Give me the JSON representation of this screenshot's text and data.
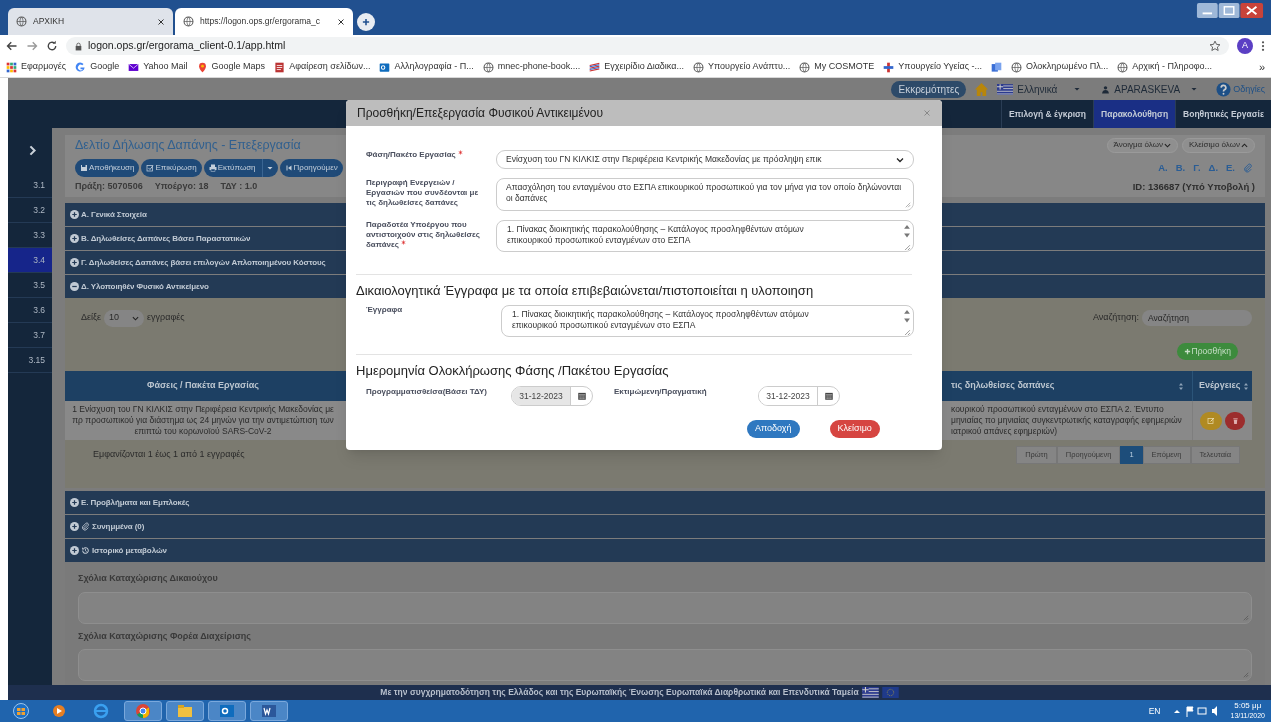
{
  "browser": {
    "tabs": [
      {
        "title": "ΑΡΧΙΚΗ",
        "selected": false
      },
      {
        "title": "https://logon.ops.gr/ergorama_c",
        "selected": true
      }
    ],
    "address": "logon.ops.gr/ergorama_client-0.1/app.html",
    "profile": "A",
    "bookmarks": [
      {
        "label": "Εφαρμογές",
        "kind": "apps"
      },
      {
        "label": "Google",
        "kind": "google"
      },
      {
        "label": "Yahoo Mail",
        "kind": "mail"
      },
      {
        "label": "Google Maps",
        "kind": "pin"
      },
      {
        "label": "Αφαίρεση σελίδων...",
        "kind": "pdf"
      },
      {
        "label": "Αλληλογραφία - Π...",
        "kind": "outlook"
      },
      {
        "label": "mnec-phone-book....",
        "kind": "globe"
      },
      {
        "label": "Εγχειρίδιο Διαδικα...",
        "kind": "stripes"
      },
      {
        "label": "Υπουργείο Ανάπτυ...",
        "kind": "globe"
      },
      {
        "label": "My COSMOTE",
        "kind": "globe"
      },
      {
        "label": "Υπουργείο Υγείας -...",
        "kind": "cross"
      },
      {
        "kind": "docs"
      },
      {
        "label": "Ολοκληρωμένο Πλ...",
        "kind": "globe"
      },
      {
        "label": "Αρχική - Πληροφο...",
        "kind": "globe"
      }
    ],
    "bookmarks_more": "»"
  },
  "header": {
    "pending": "Εκκρεμότητες",
    "language": "Ελληνικά",
    "user": "APARASKEVA",
    "help": "Οδηγίες"
  },
  "nav": [
    {
      "label": "Επιλογή & έγκριση",
      "selected": false
    },
    {
      "label": "Παρακολούθηση",
      "selected": true
    },
    {
      "label": "Βοηθητικές Εργασίε",
      "selected": false
    }
  ],
  "sidebar": [
    {
      "label": "3.1",
      "selected": false
    },
    {
      "label": "3.2",
      "selected": false
    },
    {
      "label": "3.3",
      "selected": false
    },
    {
      "label": "3.4",
      "selected": true
    },
    {
      "label": "3.5",
      "selected": false
    },
    {
      "label": "3.6",
      "selected": false
    },
    {
      "label": "3.7",
      "selected": false
    },
    {
      "label": "3.15",
      "selected": false
    }
  ],
  "form": {
    "title": "Δελτίο Δήλωσης Δαπάνης - Επεξεργασία",
    "toolbar": [
      {
        "label": "Αποθήκευση",
        "kind": "save"
      },
      {
        "label": "Επικύρωση",
        "kind": "check"
      },
      {
        "label": "Εκτύπωση",
        "kind": "print"
      },
      {
        "label": "Προηγούμεν",
        "kind": "previous"
      }
    ],
    "info": [
      "Πράξη: 5070506",
      "Υποέργο: 18",
      "ΤΔΥ : 1.0"
    ],
    "expand_all": "Άνοιγμα όλων",
    "collapse_all": "Κλείσιμο όλων",
    "section_links": [
      "Α.",
      "Β.",
      "Γ.",
      "Δ.",
      "Ε."
    ],
    "record_id": "ID: 136687 (Υπό Υποβολή )"
  },
  "sections_top": [
    {
      "label": "Α. Γενικά Στοιχεία",
      "expanded": false
    },
    {
      "label": "Β. Δηλωθείσες Δαπάνες Βάσει Παραστατικών",
      "expanded": false
    },
    {
      "label": "Γ. Δηλωθείσες Δαπάνες βάσει επιλογών Απλοποιημένου Κόστους",
      "expanded": false
    },
    {
      "label": "Δ. Υλοποιηθέν Φυσικό Αντικείμενο",
      "expanded": true
    }
  ],
  "objects": {
    "show_prefix": "Δείξε",
    "page_size": "10",
    "show_suffix": "εγγραφές",
    "search_label": "Αναζήτηση:",
    "search_placeholder": "Αναζήτηση",
    "add": "Προσθήκη",
    "columns": [
      "Φάσεις / Πακέτα Εργασίας",
      "τις δηλωθείσες δαπάνες",
      "Ενέργειες"
    ],
    "rows": [
      {
        "phase": "1 Ενίσχυση του ΓΝ ΚΙΛΚΙΣ στην Περιφέρεια Κεντρικής Μακεδονίας με πρ προσωπικού για διάστημα ως 24 μηνών για την αντιμετώπιση των επιπτώ του κορωνοϊού SARS-CoV-2",
        "deliverables": "κουρικού προσωπικού ενταγμένων στο ΕΣΠΑ 2. Έντυπο μηνιαίας πο μηνιαίας συγκεντρωτικής καταγραφής εφημεριών ιατρικού απάνες εφημεριών)"
      }
    ],
    "summary": "Εμφανίζονται 1 έως 1 από 1 εγγραφές",
    "pagination": [
      {
        "label": "Πρώτη",
        "selected": false
      },
      {
        "label": "Προηγούμενη",
        "selected": false
      },
      {
        "label": "1",
        "selected": true
      },
      {
        "label": "Επόμενη",
        "selected": false
      },
      {
        "label": "Τελευταία",
        "selected": false
      }
    ]
  },
  "sections_bottom": [
    {
      "label": "Ε. Προβλήματα και Εμπλοκές",
      "kind": "plain",
      "expanded": false
    },
    {
      "label": "Συνημμένα (0)",
      "kind": "attachments",
      "expanded": false
    },
    {
      "label": "Ιστορικό μεταβολών",
      "kind": "history",
      "expanded": false
    }
  ],
  "comments": [
    "Σχόλια Καταχώρισης Δικαιούχου",
    "Σχόλια Καταχώρισης Φορέα Διαχείρισης"
  ],
  "footer": "Με την συγχρηματοδότηση της Ελλάδος και της Ευρωπαϊκής Ένωσης Ευρωπαϊκά Διαρθρωτικά και Επενδυτικά Ταμεία",
  "modal": {
    "title": "Προσθήκη/Επεξεργασία Φυσικού Αντικειμένου",
    "fields": [
      {
        "label": "Φάση/Πακέτο Εργασίας",
        "required": true,
        "kind": "select",
        "value": "Ενίσχυση του ΓΝ ΚΙΛΚΙΣ στην Περιφέρεια Κεντρικής Μακεδονίας με πρόσληψη επικ"
      },
      {
        "label": "Περιγραφή Ενεργειών / Εργασιών που συνδέονται με τις δηλωθείσες δαπάνες",
        "required": false,
        "kind": "textarea",
        "value": "Απασχόληση του ενταγμένου στο ΕΣΠΑ επικουρικού προσωπικού για τον μήνα για τον οποίο δηλώνονται οι δαπάνες"
      },
      {
        "label": "Παραδοτέα Υποέργου που αντιστοιχούν στις δηλωθείσες δαπάνες",
        "required": true,
        "kind": "scroll",
        "value": "1.    Πίνακας διοικητικής παρακολούθησης – Κατάλογος προσληφθέντων ατόμων\nεπικουρικού προσωπικού ενταγμένων στο ΕΣΠΑ"
      }
    ],
    "documents_heading": "Δικαιολογητικά Έγγραφα με τα οποία επιβεβαιώνεται/πιστοποιείται η υλοποιηση",
    "documents": {
      "label": "Έγγραφα",
      "value": "1.    Πίνακας διοικητικής παρακολούθησης – Κατάλογος προσληφθέντων ατόμων\nεπικουρικού προσωπικού ενταγμένων στο ΕΣΠΑ"
    },
    "dates_heading": "Ημερομηνία Ολοκλήρωσης Φάσης /Πακέτου Εργασίας",
    "dates": [
      {
        "label": "Προγραμματισθείσα(Βάσει ΤΔΥ)",
        "value": "31-12-2023",
        "disabled": true
      },
      {
        "label": "Εκτιμώμενη/Πραγματική",
        "value": "31-12-2023",
        "disabled": false
      }
    ],
    "accept": "Αποδοχή",
    "close": "Κλείσιμο"
  },
  "taskbar": {
    "language": "EN",
    "time": "5:05 μμ",
    "date": "13/11/2020"
  }
}
